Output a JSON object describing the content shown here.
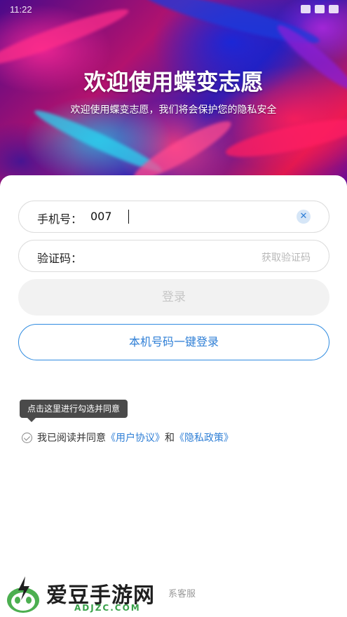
{
  "status_bar": {
    "time": "11:22"
  },
  "hero": {
    "title": "欢迎使用蝶变志愿",
    "subtitle": "欢迎使用蝶变志愿，我们将会保护您的隐私安全"
  },
  "form": {
    "phone": {
      "label": "手机号：",
      "value": "007"
    },
    "code": {
      "label": "验证码：",
      "get_code_label": "获取验证码"
    },
    "login_label": "登录",
    "one_key_login_label": "本机号码一键登录"
  },
  "tooltip": "点击这里进行勾选并同意",
  "agreement": {
    "prefix": "我已阅读并同意",
    "user_agreement": "《用户协议》",
    "and": "和",
    "privacy_policy": "《隐私政策》"
  },
  "watermark": {
    "name": "爱豆手游网",
    "url": "ADJZC.COM"
  },
  "footer": {
    "service_text": "系客服"
  },
  "colors": {
    "accent": "#2f7fd6",
    "login_disabled_bg": "#f2f2f2",
    "tooltip_bg": "#4a4a4a"
  }
}
